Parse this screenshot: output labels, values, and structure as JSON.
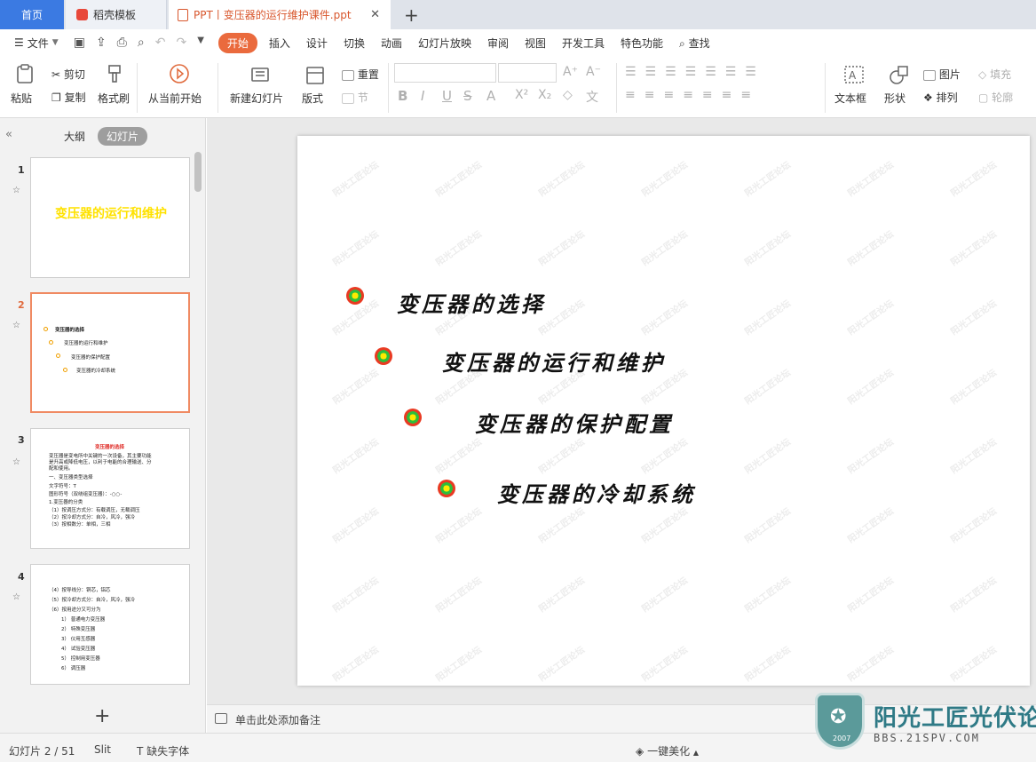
{
  "tabs": {
    "home": "首页",
    "template": "稻壳模板",
    "document": "PPT丨变压器的运行维护课件.ppt",
    "add": "+"
  },
  "menu": {
    "file": "文件",
    "items": [
      "开始",
      "插入",
      "设计",
      "切换",
      "动画",
      "幻灯片放映",
      "审阅",
      "视图",
      "开发工具",
      "特色功能"
    ],
    "search": "查找"
  },
  "ribbon": {
    "paste": "粘贴",
    "cut": "剪切",
    "copy": "复制",
    "format_painter": "格式刷",
    "play_from_current": "从当前开始",
    "new_slide": "新建幻灯片",
    "layout": "版式",
    "reset": "重置",
    "section": "节",
    "text_box": "文本框",
    "shape": "形状",
    "picture": "图片",
    "arrange": "排列",
    "fill": "填充",
    "outline": "轮廓"
  },
  "left_panel": {
    "outline_label": "大纲",
    "slides_label": "幻灯片",
    "thumbs": [
      {
        "num": "1",
        "title": "变压器的运行和维护"
      },
      {
        "num": "2",
        "lines": [
          "变压器的选择",
          "变压器的运行和维护",
          "变压器的保护配置",
          "变压器的冷却系统"
        ]
      },
      {
        "num": "3",
        "title": "变压器的选择",
        "lines": [
          "变压器是变电所中关键的一次设备，其主要功能",
          "是升高或降低电压，以利于电能的合理输送、分",
          "配和使用。",
          "一、变压器类型选择",
          "文字符号：T",
          "图形符号（双绕组变压器）：-○○-",
          "1.变压器的分类",
          "（1）按调压方式分：有载调压，无载调压",
          "（2）按冷却方式分：自冷，风冷，强冷",
          "（3）按相数分：单相，三相"
        ]
      },
      {
        "num": "4",
        "lines": [
          "（4）按导线分：铜芯，铝芯",
          "（5）按冷却方式分：自冷，风冷，强冷",
          "（6）按用途分又可分为",
          "1） 普通电力变压器",
          "2） 特殊变压器",
          "3） 仪用互感器",
          "4） 试验变压器",
          "5） 控制用变压器",
          "6） 调压器"
        ]
      }
    ]
  },
  "slide": {
    "bullets": [
      "变压器的选择",
      "变压器的运行和维护",
      "变压器的保护配置",
      "变压器的冷却系统"
    ],
    "watermark": "阳光工匠论坛"
  },
  "notes_placeholder": "单击此处添加备注",
  "status": {
    "slide_indicator": "幻灯片 2 / 51",
    "theme": "Slit",
    "missing_fonts": "缺失字体",
    "beautify": "一键美化"
  },
  "forum": {
    "name": "阳光工匠光伏论坛",
    "url": "BBS.21SPV.COM",
    "year": "2007"
  },
  "colors": {
    "accent": "#ea6a3d",
    "tab_active": "#3b7ae2",
    "selected_thumb_border": "#f08a62",
    "title_yellow": "#ffe200"
  }
}
